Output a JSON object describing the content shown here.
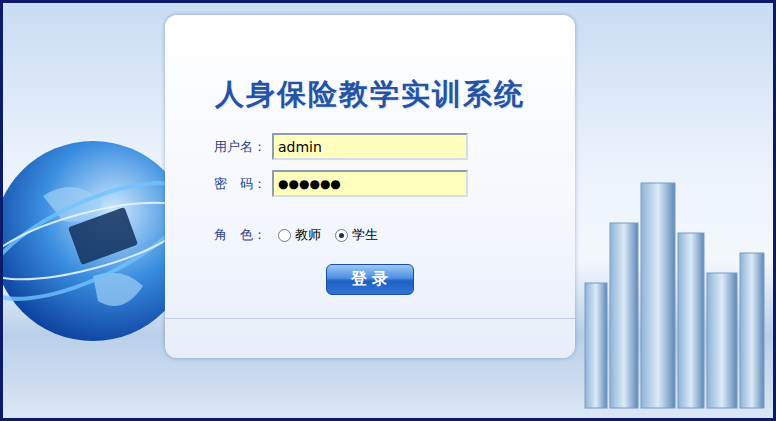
{
  "title": "人身保险教学实训系统",
  "fields": [
    {
      "label": "用户名：",
      "value": "admin",
      "kind": "text"
    },
    {
      "label": "密　码：",
      "value": "●●●●●●",
      "kind": "password"
    }
  ],
  "role": {
    "label": "角　色：",
    "options": [
      {
        "label": "教师",
        "selected": false
      },
      {
        "label": "学生",
        "selected": true
      }
    ]
  },
  "buttons": [
    "登 录"
  ]
}
